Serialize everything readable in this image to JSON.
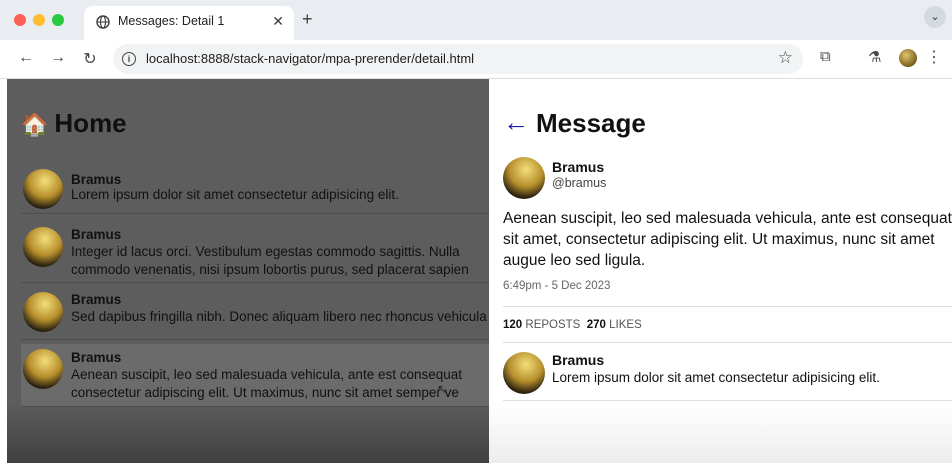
{
  "browser": {
    "tab_title": "Messages: Detail 1",
    "tab_close": "✕",
    "new_tab": "+",
    "tab_menu": "⌄",
    "url": "localhost:8888/stack-navigator/mpa-prerender/detail.html",
    "icons": [
      "globe-icon",
      "back-icon",
      "forward-icon",
      "reload-icon",
      "info-icon",
      "star-icon",
      "extensions-icon",
      "labs-icon",
      "profile-icon",
      "menu-icon"
    ]
  },
  "home": {
    "title": "Home",
    "emoji": "🏠",
    "items": [
      {
        "name": "Bramus",
        "lines": [
          "Lorem ipsum dolor sit amet consectetur adipisicing elit."
        ]
      },
      {
        "name": "Bramus",
        "lines": [
          "Integer id lacus orci. Vestibulum egestas commodo sagittis. Nulla",
          "commodo venenatis, nisi ipsum lobortis purus, sed placerat sapien"
        ]
      },
      {
        "name": "Bramus",
        "lines": [
          "Sed dapibus fringilla nibh. Donec aliquam libero nec rhoncus vehicula"
        ]
      },
      {
        "name": "Bramus",
        "lines": [
          "Aenean suscipit, leo sed malesuada vehicula, ante est consequat",
          "consectetur adipiscing elit. Ut maximus, nunc sit amet semper ve"
        ]
      }
    ]
  },
  "message": {
    "title": "Message",
    "back": "←",
    "author": "Bramus",
    "handle": "@bramus",
    "body_lines": [
      "Aenean suscipit, leo sed malesuada vehicula, ante est consequat",
      "sit amet, consectetur adipiscing elit. Ut maximus, nunc sit amet",
      "augue leo sed ligula."
    ],
    "timestamp": "6:49pm - 5 Dec 2023",
    "reposts_count": "120",
    "reposts_label": "REPOSTS",
    "likes_count": "270",
    "likes_label": "LIKES",
    "reply": {
      "name": "Bramus",
      "text": "Lorem ipsum dolor sit amet consectetur adipisicing elit."
    }
  },
  "colors": {
    "accent": "#1a1aa8",
    "dim_overlay": "#5d5d5d"
  }
}
